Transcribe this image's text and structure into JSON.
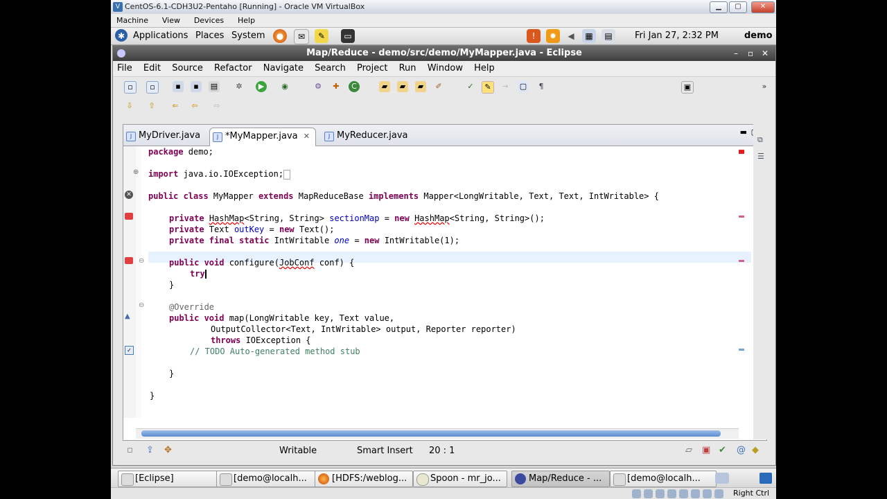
{
  "vbox": {
    "title": "CentOS-6.1-CDH3U2-Pentaho [Running] - Oracle VM VirtualBox",
    "menu": [
      "Machine",
      "View",
      "Devices",
      "Help"
    ],
    "host_key": "Right Ctrl"
  },
  "gnome_panel": {
    "menu": [
      "Applications",
      "Places",
      "System"
    ],
    "clock": "Fri Jan 27,  2:32 PM",
    "user": "demo"
  },
  "eclipse": {
    "title": "Map/Reduce - demo/src/demo/MyMapper.java - Eclipse",
    "menu": [
      "File",
      "Edit",
      "Source",
      "Refactor",
      "Navigate",
      "Search",
      "Project",
      "Run",
      "Window",
      "Help"
    ],
    "tabs": [
      {
        "label": "MyDriver.java",
        "active": false
      },
      {
        "label": "*MyMapper.java",
        "active": true
      },
      {
        "label": "MyReducer.java",
        "active": false
      }
    ],
    "tab_close": "✕",
    "code": {
      "l1": {
        "a": "package",
        "b": " demo;"
      },
      "l2": {
        "a": "import",
        "b": " java.io.IOException;"
      },
      "l3": {
        "a": "public class",
        "b": " MyMapper ",
        "c": "extends",
        "d": " MapReduceBase ",
        "e": "implements",
        "f": " Mapper<LongWritable, Text, Text, IntWritable> {"
      },
      "l4": {
        "a": "private",
        "b": "HashMap",
        "c": "<String, String> ",
        "d": "sectionMap",
        "e": " = ",
        "f": "new",
        "g": "HashMap",
        "h": "<String, String>();"
      },
      "l5": {
        "a": "private",
        "b": " Text ",
        "c": "outKey",
        "d": " = ",
        "e": "new",
        "f": " Text();"
      },
      "l6": {
        "a": "private final static",
        "b": " IntWritable ",
        "c": "one",
        "d": " = ",
        "e": "new",
        "f": " IntWritable(1);"
      },
      "l7": {
        "a": "public void",
        "b": " configure(",
        "c": "JobConf",
        "d": " conf) {"
      },
      "l8": {
        "a": "try"
      },
      "l9": {
        "a": "}"
      },
      "l10": {
        "a": "@Override"
      },
      "l11": {
        "a": "public void",
        "b": " map(LongWritable key, Text value,"
      },
      "l12": {
        "a": "OutputCollector<Text, IntWritable> output, Reporter reporter)"
      },
      "l13": {
        "a": "throws",
        "b": " IOException {"
      },
      "l14": {
        "a": "// TODO Auto-generated method stub"
      },
      "l15": {
        "a": "}"
      },
      "l16": {
        "a": "}"
      }
    },
    "status": {
      "mode": "Writable",
      "insert": "Smart Insert",
      "position": "20 : 1"
    }
  },
  "taskbar": [
    {
      "label": "[Eclipse]",
      "active": false
    },
    {
      "label": "[demo@localh...",
      "active": false
    },
    {
      "label": "[HDFS:/weblog...",
      "active": false
    },
    {
      "label": "Spoon - mr_jo...",
      "active": false
    },
    {
      "label": "Map/Reduce - ...",
      "active": true
    },
    {
      "label": "[demo@localh...",
      "active": false
    }
  ],
  "colors": {
    "keyword": "#7f0055",
    "field": "#0000c0",
    "comment": "#3f7f5f",
    "annotation": "#646464"
  }
}
